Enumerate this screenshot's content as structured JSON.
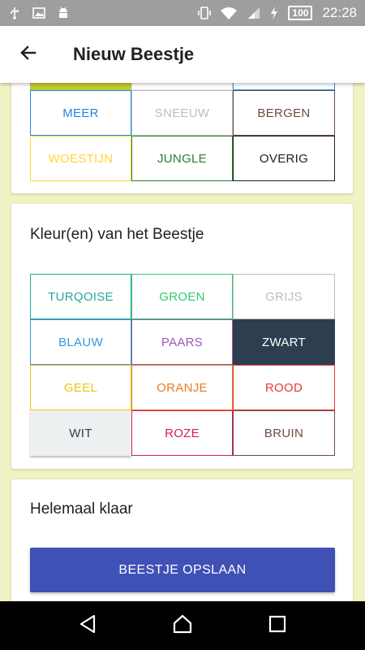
{
  "status": {
    "time": "22:28",
    "battery": "100"
  },
  "header": {
    "title": "Nieuw Beestje"
  },
  "habitat": {
    "top_colors": [
      "#c0ca33",
      "#e0e0e0",
      "#2196f3"
    ],
    "rows": [
      [
        {
          "label": "MEER",
          "color": "#1e88e5"
        },
        {
          "label": "SNEEUW",
          "color": "#bdbdbd"
        },
        {
          "label": "BERGEN",
          "color": "#6d4c41"
        }
      ],
      [
        {
          "label": "WOESTIJN",
          "color": "#fdd835"
        },
        {
          "label": "JUNGLE",
          "color": "#2e7d32"
        },
        {
          "label": "OVERIG",
          "color": "#212121"
        }
      ]
    ]
  },
  "colors_card": {
    "title": "Kleur(en) van het Beestje",
    "items": [
      {
        "label": "TURQOISE",
        "color": "#26a69a",
        "selected": false
      },
      {
        "label": "GROEN",
        "color": "#2ecc71",
        "selected": false
      },
      {
        "label": "GRIJS",
        "color": "#bdbdbd",
        "selected": false
      },
      {
        "label": "BLAUW",
        "color": "#3498db",
        "selected": false
      },
      {
        "label": "PAARS",
        "color": "#9b59b6",
        "selected": false
      },
      {
        "label": "ZWART",
        "color": "#2c3e50",
        "selected": true
      },
      {
        "label": "GEEL",
        "color": "#f1c40f",
        "selected": false
      },
      {
        "label": "ORANJE",
        "color": "#e67e22",
        "selected": false
      },
      {
        "label": "ROOD",
        "color": "#e53935",
        "selected": false
      },
      {
        "label": "WIT",
        "color": "#ecf0f1",
        "selected": true
      },
      {
        "label": "ROZE",
        "color": "#d81b60",
        "selected": false
      },
      {
        "label": "BRUIN",
        "color": "#6d4c41",
        "selected": false
      }
    ]
  },
  "finish_card": {
    "title": "Helemaal klaar",
    "save_label": "BEESTJE OPSLAAN"
  }
}
